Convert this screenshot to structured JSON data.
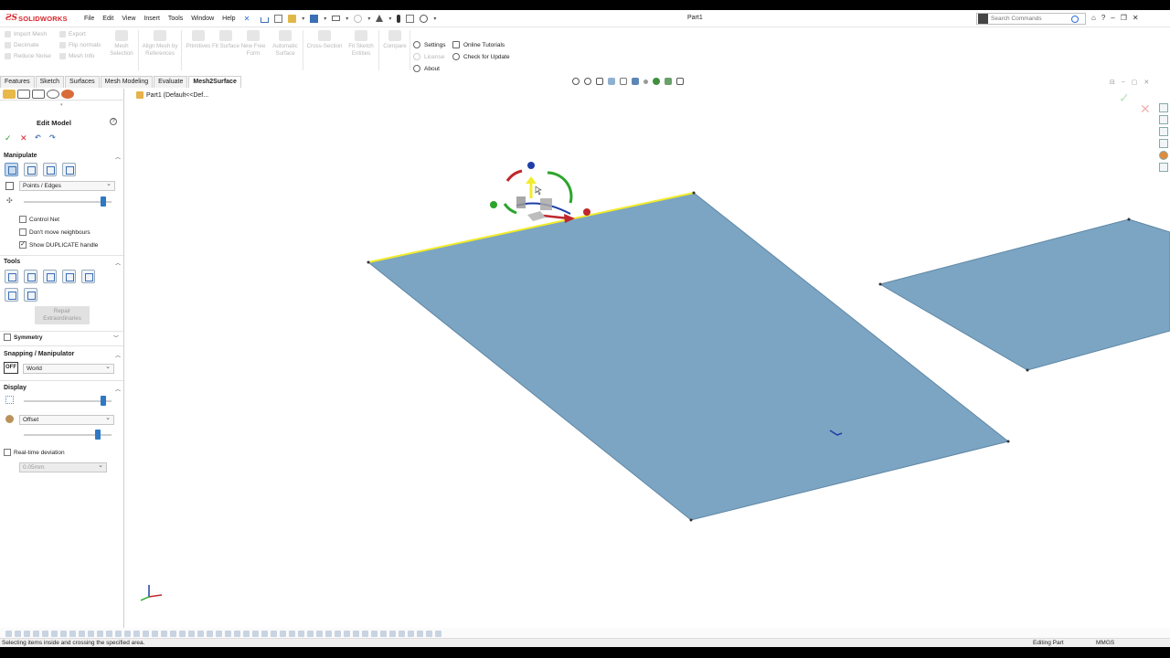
{
  "app": {
    "brand": "SOLIDWORKS",
    "document_title": "Part1",
    "menu": [
      "File",
      "Edit",
      "View",
      "Insert",
      "Tools",
      "Window",
      "Help"
    ],
    "search_placeholder": "Search Commands",
    "title_right": [
      "⌂",
      "?",
      "–",
      "❐",
      "✕"
    ]
  },
  "ribbon": {
    "small_items": [
      "Import Mesh",
      "Decimate",
      "Reduce Noise",
      "Export",
      "Flip normals",
      "Mesh Info"
    ],
    "big_buttons": [
      "Mesh Selection",
      "Align Mesh by References",
      "Primitives",
      "Fit Surface",
      "New Free Form",
      "Automatic Surface",
      "Cross-Section",
      "Fit Sketch Entities",
      "Compare"
    ],
    "options": [
      "Settings",
      "License",
      "About",
      "Online Tutorials",
      "Check for Update"
    ]
  },
  "command_tabs": [
    "Features",
    "Sketch",
    "Surfaces",
    "Mesh Modeling",
    "Evaluate",
    "Mesh2Surface"
  ],
  "active_tab": "Mesh2Surface",
  "feature_tree": {
    "part_label": "Part1  (Default<<Def..."
  },
  "property_manager": {
    "title": "Edit Model",
    "manipulate": {
      "header": "Manipulate",
      "selection_mode": "Points / Edges",
      "slider_level": 0.93,
      "checkboxes": [
        {
          "label": "Control Net",
          "checked": false
        },
        {
          "label": "Don't move neighbours",
          "checked": false
        },
        {
          "label": "Show DUPLICATE handle",
          "checked": true
        }
      ]
    },
    "tools": {
      "header": "Tools",
      "repair_button": "Repair Extraordinaries"
    },
    "symmetry": {
      "header": "Symmetry",
      "checked": false
    },
    "snapping": {
      "header": "Snapping / Manipulator",
      "toggle": "OFF",
      "frame": "World"
    },
    "display": {
      "header": "Display",
      "slider_level": 0.93,
      "mode": "Offset",
      "offset_level": 0.87,
      "realtime_label": "Real-time deviation",
      "realtime_checked": false,
      "deviation_value": "0.05mm"
    }
  },
  "status_bar": {
    "message": "Selecting items inside and crossing the specified area.",
    "editing": "Editing Part",
    "units": "MMGS"
  },
  "colors": {
    "surface_fill": "#7ba5c2",
    "surface_edge": "#5f87a6",
    "selected_edge": "#f2ec2b",
    "brand_red": "#d8262d",
    "active_blue": "#2f78c4"
  }
}
